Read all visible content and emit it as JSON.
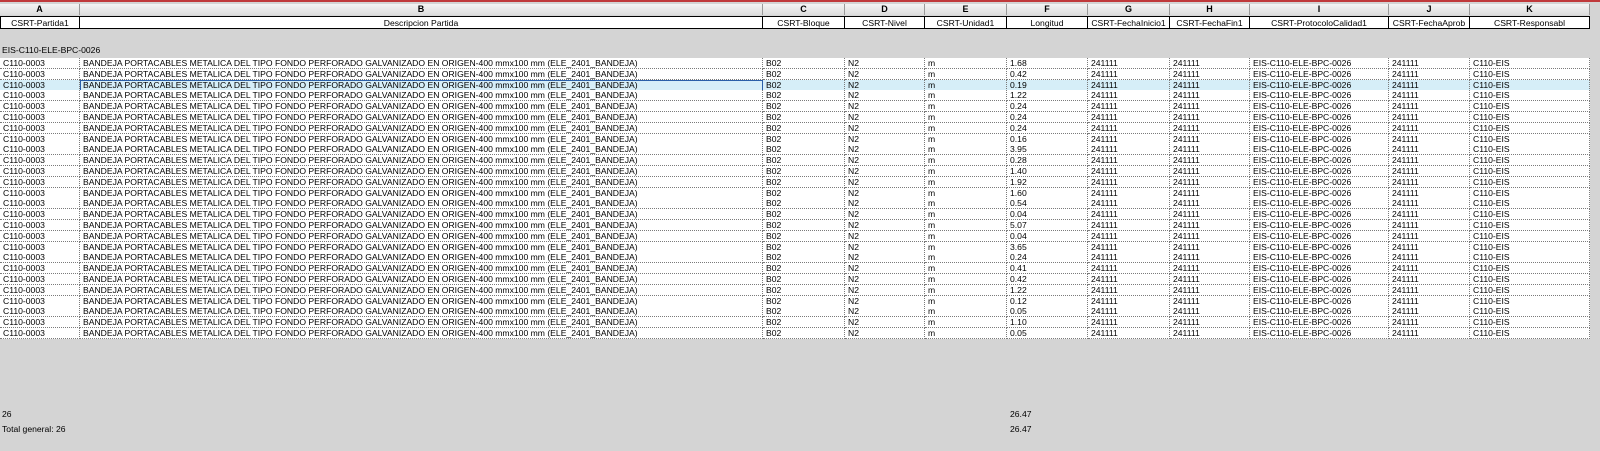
{
  "column_letters": [
    "A",
    "B",
    "C",
    "D",
    "E",
    "F",
    "G",
    "H",
    "I",
    "J",
    "K"
  ],
  "field_headers": [
    "CSRT-Partida1",
    "Descripcion Partida",
    "CSRT-Bloque",
    "CSRT-Nivel",
    "CSRT-Unidad1",
    "Longitud",
    "CSRT-FechaInicio1",
    "CSRT-FechaFin1",
    "CSRT-ProtocoloCalidad1",
    "CSRT-FechaAprob",
    "CSRT-Responsabl"
  ],
  "group_label": "EIS-C110-ELE-BPC-0026",
  "row_template": {
    "partida": "C110-0003",
    "descripcion": "BANDEJA PORTACABLES METALICA DEL TIPO FONDO PERFORADO GALVANIZADO EN ORIGEN-400 mmx100 mm (ELE_2401_BANDEJA)",
    "bloque": "B02",
    "nivel": "N2",
    "unidad": "m",
    "fecha_inicio": "241111",
    "fecha_fin": "241111",
    "protocolo": "EIS-C110-ELE-BPC-0026",
    "fecha_aprob": "241111",
    "responsable": "C110-EIS"
  },
  "longitudes": [
    "1.68",
    "0.42",
    "0.19",
    "1.22",
    "0.24",
    "0.24",
    "0.24",
    "0.16",
    "3.95",
    "0.28",
    "1.40",
    "1.92",
    "1.60",
    "0.54",
    "0.04",
    "5.07",
    "0.04",
    "3.65",
    "0.24",
    "0.41",
    "0.42",
    "1.22",
    "0.12",
    "0.05",
    "1.10",
    "0.05"
  ],
  "selected_row": 2,
  "footer": {
    "count": "26",
    "subtotal": "26.47",
    "total_label": "Total general: 26",
    "total": "26.47"
  }
}
